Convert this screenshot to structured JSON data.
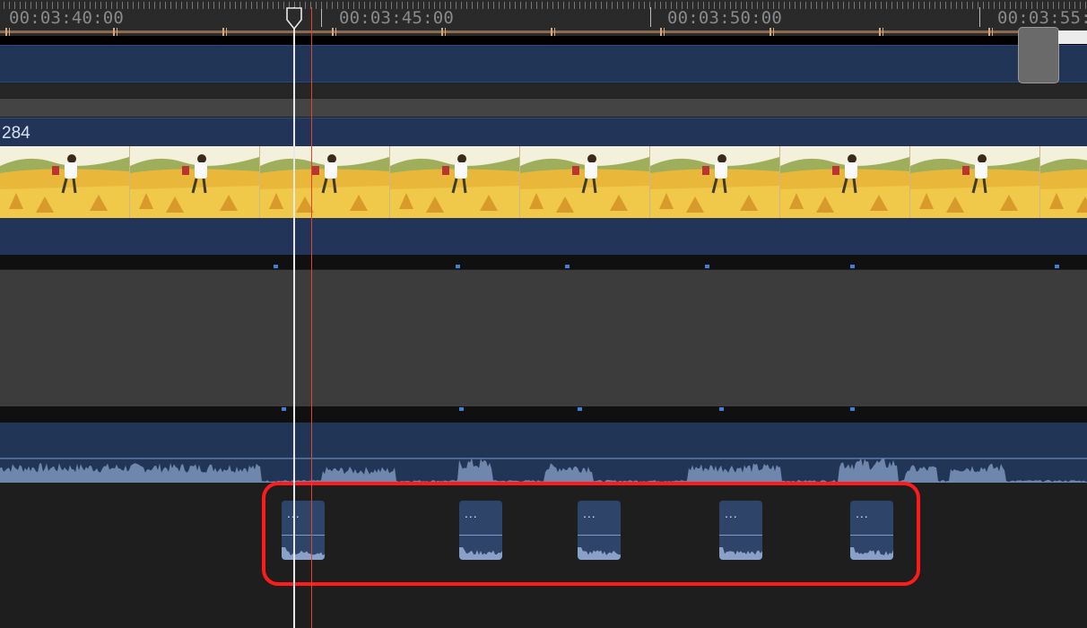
{
  "ruler": {
    "timecodes": [
      "00:03:40:00",
      "00:03:45:00",
      "00:03:50:00",
      "00:03:55:"
    ]
  },
  "video_clip": {
    "label": "284"
  },
  "subclips": [
    {
      "dots": "..."
    },
    {
      "dots": "..."
    },
    {
      "dots": "..."
    },
    {
      "dots": "..."
    },
    {
      "dots": "..."
    }
  ],
  "colors": {
    "track_blue": "#213556",
    "highlight": "#ff1b1b",
    "playhead_red": "#e0432e"
  }
}
